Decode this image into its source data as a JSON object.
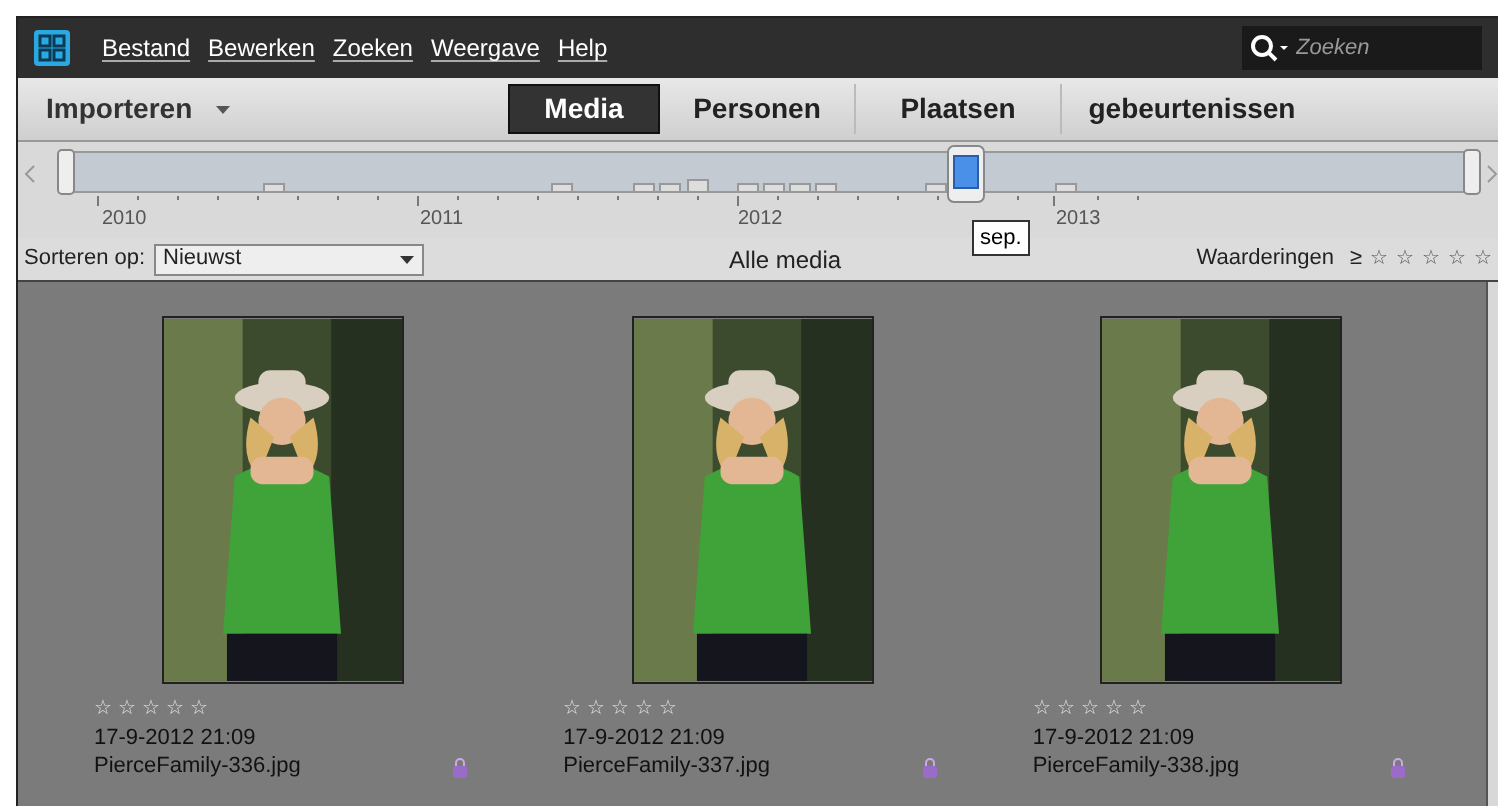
{
  "menu": [
    "Bestand",
    "Bewerken",
    "Zoeken",
    "Weergave",
    "Help"
  ],
  "search": {
    "placeholder": "Zoeken"
  },
  "import_button": "Importeren",
  "tabs": [
    {
      "label": "Media",
      "selected": true
    },
    {
      "label": "Personen",
      "selected": false
    },
    {
      "label": "Plaatsen",
      "selected": false
    },
    {
      "label": "gebeurtenissen",
      "selected": false
    }
  ],
  "timeline": {
    "years": [
      "2010",
      "2011",
      "2012",
      "2013"
    ],
    "tooltip": "sep."
  },
  "sort": {
    "label": "Sorteren op:",
    "value": "Nieuwst"
  },
  "view_label": "Alle media",
  "ratings": {
    "label": "Waarderingen",
    "operator": "≥",
    "stars": 0
  },
  "items": [
    {
      "stars": 0,
      "date": "17-9-2012 21:09",
      "filename": "PierceFamily-336.jpg"
    },
    {
      "stars": 0,
      "date": "17-9-2012 21:09",
      "filename": "PierceFamily-337.jpg"
    },
    {
      "stars": 0,
      "date": "17-9-2012 21:09",
      "filename": "PierceFamily-338.jpg"
    }
  ]
}
